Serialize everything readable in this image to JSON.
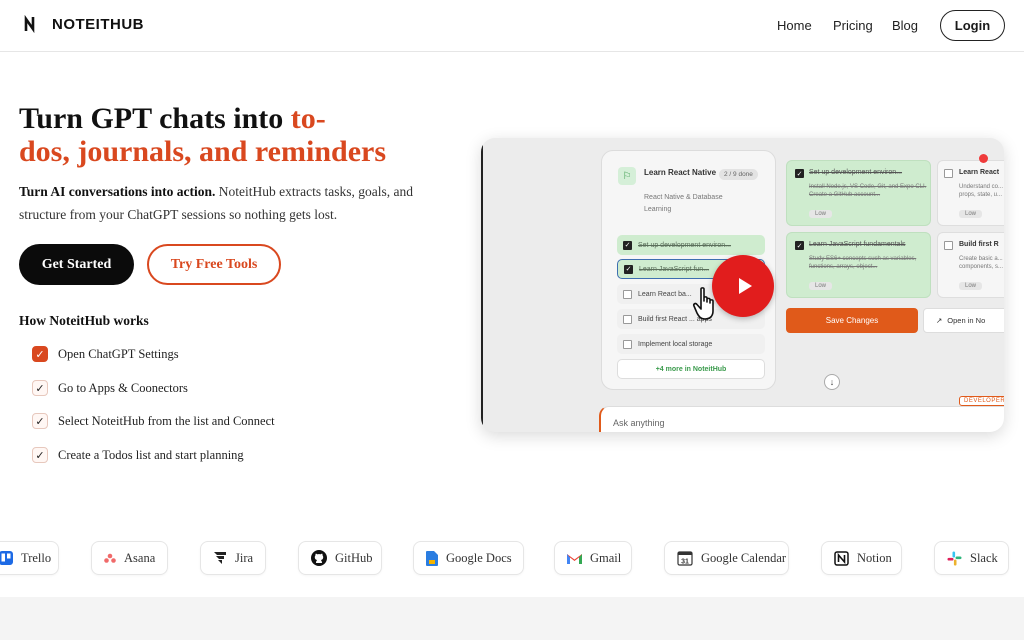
{
  "nav": {
    "brand": "NOTEITHUB",
    "links": [
      "Home",
      "Pricing",
      "Blog"
    ],
    "login": "Login"
  },
  "hero": {
    "title_plain": "Turn GPT chats into ",
    "title_accent_1": "to-",
    "title_accent_2": "dos, journals, and reminders",
    "sub_bold": "Turn AI conversations into action.",
    "sub_rest": " NoteitHub extracts tasks, goals, and structure from your ChatGPT sessions so nothing gets lost.",
    "cta_primary": "Get Started",
    "cta_secondary": "Try Free Tools",
    "how_title": "How NoteitHub works",
    "steps": [
      "Open ChatGPT Settings",
      "Go to Apps & Coonectors",
      "Select NoteitHub from the list and Connect",
      "Create a Todos list and start planning"
    ]
  },
  "video": {
    "card_title": "Learn React Native",
    "card_sub": "React Native & Database Learning",
    "badge": "2 / 9  done",
    "rows": [
      "Set up development environ...",
      "Learn JavaScript fun...",
      "Learn React ba...",
      "Build first React ... apps",
      "Implement local storage"
    ],
    "more": "+4 more in NoteitHub",
    "g1_title": "Set up development environ...",
    "g1_desc": "Install Node.js, VS Code, Git, and Expo CLI. Create a GitHub account...",
    "g2_title": "Learn JavaScript fundamentals",
    "g2_desc": "Study ES6+ concepts such as variables, functions, arrays, object...",
    "w1_title": "Learn React",
    "w1_desc": "Understand co... props, state, u...",
    "w2_title": "Build first R",
    "w2_desc": "Create basic a... components, s...",
    "tag": "Low",
    "save": "Save Changes",
    "open": "Open in No",
    "ask": "Ask anything",
    "dev": "DEVELOPER"
  },
  "integrations": [
    {
      "name": "Trello",
      "icon": "trello-icon",
      "color": "#1d6ae5"
    },
    {
      "name": "Asana",
      "icon": "asana-icon",
      "color": "#f06a6a"
    },
    {
      "name": "Jira",
      "icon": "jira-icon",
      "color": "#222222"
    },
    {
      "name": "GitHub",
      "icon": "github-icon",
      "color": "#111111"
    },
    {
      "name": "Google Docs",
      "icon": "google-docs-icon",
      "color": "#2a7de1"
    },
    {
      "name": "Gmail",
      "icon": "gmail-icon",
      "color": "#ea4335"
    },
    {
      "name": "Google Calendar",
      "icon": "google-calendar-icon",
      "color": "#333333"
    },
    {
      "name": "Notion",
      "icon": "notion-icon",
      "color": "#111111"
    },
    {
      "name": "Slack",
      "icon": "slack-icon",
      "color": "#e01e5a"
    }
  ],
  "colors": {
    "accent": "#d9481f",
    "play": "#e11d1d"
  }
}
